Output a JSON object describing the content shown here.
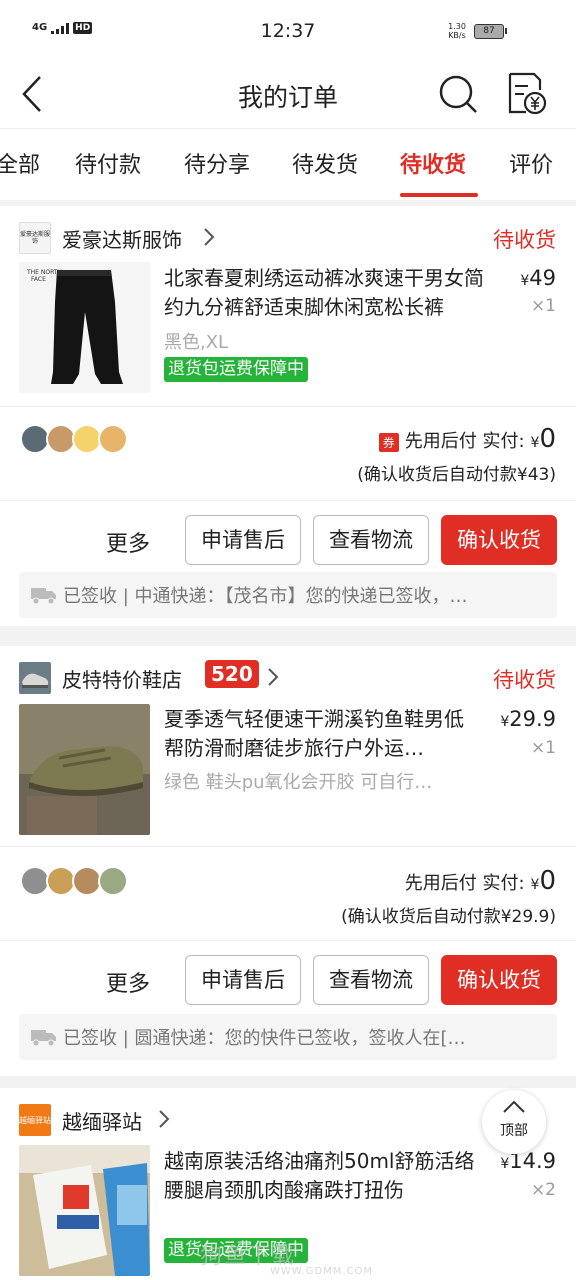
{
  "status_bar": {
    "network": "4G",
    "hd": "HD",
    "time": "12:37",
    "speed_value": "1.30",
    "speed_unit": "KB/s",
    "battery": "87"
  },
  "header": {
    "title": "我的订单",
    "back_icon": "chevron-left-icon",
    "search_icon": "search-icon",
    "bill_icon": "yen-receipt-icon"
  },
  "tabs": [
    {
      "label": "全部",
      "active": false
    },
    {
      "label": "待付款",
      "active": false
    },
    {
      "label": "待分享",
      "active": false
    },
    {
      "label": "待发货",
      "active": false
    },
    {
      "label": "待收货",
      "active": true
    },
    {
      "label": "评价",
      "active": false
    }
  ],
  "orders": [
    {
      "shop_logo_text": "爱豪达斯服饰",
      "shop_name": "爱豪达斯服饰",
      "status": "待收货",
      "product_title": "北家春夏刺绣运动裤冰爽速干男女简约九分裤舒适束脚休闲宽松长裤",
      "price_symbol": "¥",
      "price": "49",
      "quantity": "×1",
      "spec": "黑色,XL",
      "guarantee": "退货包运费保障中",
      "coupon": "券",
      "pay_label": "先用后付 实付:",
      "pay_symbol": "¥",
      "pay_amount": "0",
      "auto_pay_note": "(确认收货后自动付款¥43)",
      "more": "更多",
      "btn_after_sale": "申请售后",
      "btn_logistics": "查看物流",
      "btn_confirm": "确认收货",
      "logistics_text": "已签收 | 中通快递：【茂名市】您的快递已签收，…"
    },
    {
      "shop_name": "皮特特价鞋店",
      "shop_badge": "520",
      "status": "待收货",
      "product_title": "夏季透气轻便速干溯溪钓鱼鞋男低帮防滑耐磨徒步旅行户外运…",
      "price_symbol": "¥",
      "price": "29.9",
      "quantity": "×1",
      "spec": "绿色 鞋头pu氧化会开胶 可自行…",
      "pay_label": "先用后付 实付:",
      "pay_symbol": "¥",
      "pay_amount": "0",
      "auto_pay_note": "(确认收货后自动付款¥29.9)",
      "more": "更多",
      "btn_after_sale": "申请售后",
      "btn_logistics": "查看物流",
      "btn_confirm": "确认收货",
      "logistics_text": "已签收 | 圆通快递：您的快件已签收，签收人在[…"
    },
    {
      "shop_logo_text": "越缅驿站",
      "shop_name": "越缅驿站",
      "product_title": "越南原装活络油痛剂50ml舒筋活络腰腿肩颈肌肉酸痛跌打扭伤",
      "price_symbol": "¥",
      "price": "14.9",
      "quantity": "×2",
      "guarantee": "退货包运费保障中"
    }
  ],
  "back_to_top": "顶部",
  "watermark": {
    "text": "狗鱼下载",
    "url": "WWW.GDMM.COM"
  },
  "colors": {
    "accent": "#e02e24",
    "guarantee": "#25b33a",
    "background": "#f2f2f2"
  }
}
